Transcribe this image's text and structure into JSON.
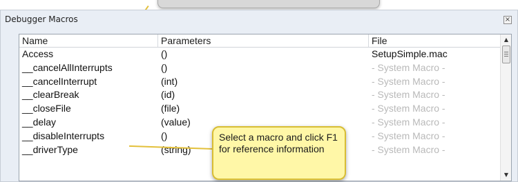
{
  "panel": {
    "title": "Debugger Macros",
    "close_label": "×"
  },
  "columns": [
    "Name",
    "Parameters",
    "File"
  ],
  "rows": [
    {
      "name": "Access",
      "params": "()",
      "file": "SetupSimple.mac",
      "system": false
    },
    {
      "name": "__cancelAllInterrupts",
      "params": "()",
      "file": "- System Macro -",
      "system": true
    },
    {
      "name": "__cancelInterrupt",
      "params": "(int)",
      "file": "- System Macro -",
      "system": true
    },
    {
      "name": "__clearBreak",
      "params": "(id)",
      "file": "- System Macro -",
      "system": true
    },
    {
      "name": "__closeFile",
      "params": "(file)",
      "file": "- System Macro -",
      "system": true
    },
    {
      "name": "__delay",
      "params": "(value)",
      "file": "- System Macro -",
      "system": true
    },
    {
      "name": "__disableInterrupts",
      "params": "()",
      "file": "- System Macro -",
      "system": true
    },
    {
      "name": "__driverType",
      "params": "(string)",
      "file": "- System Macro -",
      "system": true
    }
  ],
  "note": {
    "text": "Select a macro and click F1 for reference information"
  },
  "scroll": {
    "up_icon": "chevron-up-icon",
    "down_icon": "chevron-down-icon"
  },
  "colors": {
    "panel_bg": "#e9eef5",
    "system_text": "#b9b9b9",
    "note_bg": "#fff7a7",
    "note_border": "#d8bd33"
  }
}
